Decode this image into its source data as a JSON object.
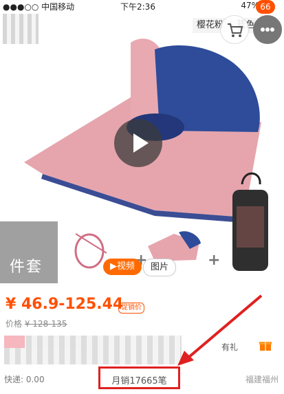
{
  "status_bar": {
    "carrier": "●●●○○ 中国移动",
    "time": "下午2:36",
    "battery": "47%"
  },
  "header": {
    "color_option": "樱花粉 + 蓝色",
    "badge_count": "66"
  },
  "media": {
    "set_label": "件套",
    "video_label": "▶视频",
    "image_label": "图片"
  },
  "product": {
    "price": "¥ 46.9-125.44",
    "promo_tag": "促销价",
    "original_price_label": "价格",
    "original_price": "¥ 128-135",
    "gift_text": "有礼",
    "shipping": "快递: 0.00",
    "monthly_sales": "月销17665笔",
    "location": "福建福州"
  },
  "colors": {
    "accent": "#ff5000",
    "highlight_box": "#e02020"
  },
  "icons": {
    "cart": "cart-icon",
    "more": "more-icon",
    "play": "play-icon",
    "gift": "gift-icon"
  }
}
